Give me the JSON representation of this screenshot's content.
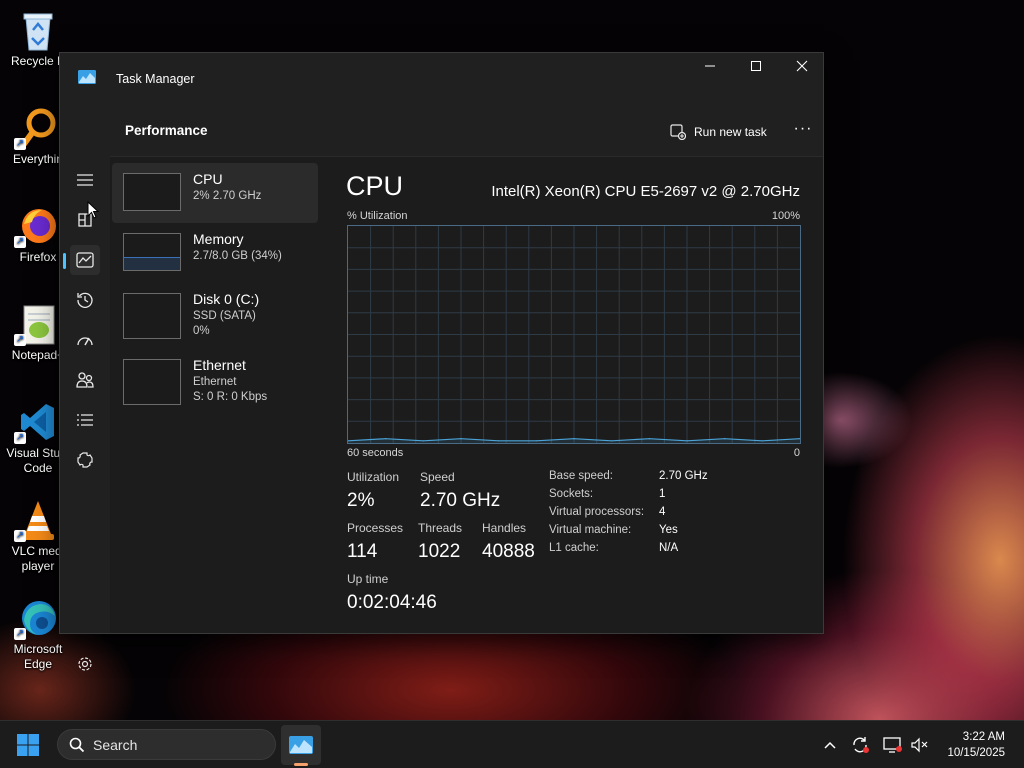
{
  "desktop": {
    "icons": [
      {
        "label": "Recycle B",
        "icon": "recycle-bin-icon"
      },
      {
        "label": "Everythin",
        "icon": "everything-search-icon"
      },
      {
        "label": "Firefox",
        "icon": "firefox-icon"
      },
      {
        "label": "Notepad+",
        "icon": "notepad-plus-plus-icon"
      },
      {
        "label": "Visual Studi Code",
        "line1": "Visual Studi",
        "line2": "Code",
        "icon": "vscode-icon"
      },
      {
        "label": "VLC media player",
        "line1": "VLC medi",
        "line2": "player",
        "icon": "vlc-icon"
      },
      {
        "label": "Microsoft Edge",
        "line1": "Microsoft",
        "line2": "Edge",
        "icon": "edge-icon"
      }
    ]
  },
  "window": {
    "title": "Task Manager",
    "controls": {
      "minimize": "—",
      "maximize": "☐",
      "close": "✕"
    }
  },
  "header": {
    "page_title": "Performance",
    "run_new_task": "Run new task",
    "more": "···"
  },
  "nav": {
    "items": [
      "menu-icon",
      "processes-icon",
      "performance-icon",
      "app-history-icon",
      "startup-apps-icon",
      "users-icon",
      "details-icon",
      "services-icon"
    ],
    "active": "performance-icon",
    "settings": "settings-icon"
  },
  "devices": [
    {
      "name": "CPU",
      "sub1": "2% 2.70 GHz",
      "sub2": "",
      "selected": true,
      "fill": 0.02
    },
    {
      "name": "Memory",
      "sub1": "2.7/8.0 GB (34%)",
      "sub2": "",
      "selected": false,
      "fill": 0.34
    },
    {
      "name": "Disk 0 (C:)",
      "sub1": "SSD (SATA)",
      "sub2": "0%",
      "selected": false,
      "fill": 0
    },
    {
      "name": "Ethernet",
      "sub1": "Ethernet",
      "sub2": "S: 0 R: 0 Kbps",
      "selected": false,
      "fill": 0
    }
  ],
  "cpu": {
    "heading": "CPU",
    "model": "Intel(R) Xeon(R) CPU E5-2697 v2 @ 2.70GHz",
    "graph": {
      "y_label": "% Utilization",
      "y_max_label": "100%",
      "x_left_label": "60 seconds",
      "x_right_label": "0"
    },
    "stats": {
      "utilization_label": "Utilization",
      "utilization": "2%",
      "speed_label": "Speed",
      "speed": "2.70 GHz",
      "processes_label": "Processes",
      "processes": "114",
      "threads_label": "Threads",
      "threads": "1022",
      "handles_label": "Handles",
      "handles": "40888",
      "uptime_label": "Up time",
      "uptime": "0:02:04:46"
    },
    "specs": [
      {
        "label": "Base speed:",
        "value": "2.70 GHz"
      },
      {
        "label": "Sockets:",
        "value": "1"
      },
      {
        "label": "Virtual processors:",
        "value": "4"
      },
      {
        "label": "Virtual machine:",
        "value": "Yes"
      },
      {
        "label": "L1 cache:",
        "value": "N/A"
      }
    ]
  },
  "chart_data": {
    "type": "line",
    "title": "",
    "xlabel": "60 seconds",
    "ylabel": "% Utilization",
    "ylim": [
      0,
      100
    ],
    "xlim": [
      60,
      0
    ],
    "x": [
      60,
      55,
      50,
      45,
      40,
      35,
      30,
      25,
      20,
      15,
      10,
      5,
      0
    ],
    "series": [
      {
        "values": [
          1,
          2,
          1,
          2,
          1,
          1,
          2,
          1,
          2,
          1,
          2,
          1,
          2
        ]
      }
    ],
    "grid": true
  },
  "taskbar": {
    "search_placeholder": "Search",
    "time": "3:22 AM",
    "date": "10/15/2025"
  },
  "colors": {
    "accent": "#4cc2ff",
    "graph_line": "#4aa3d8",
    "graph_border": "#4a6a86",
    "memory_fill": "#3b6fb6"
  }
}
